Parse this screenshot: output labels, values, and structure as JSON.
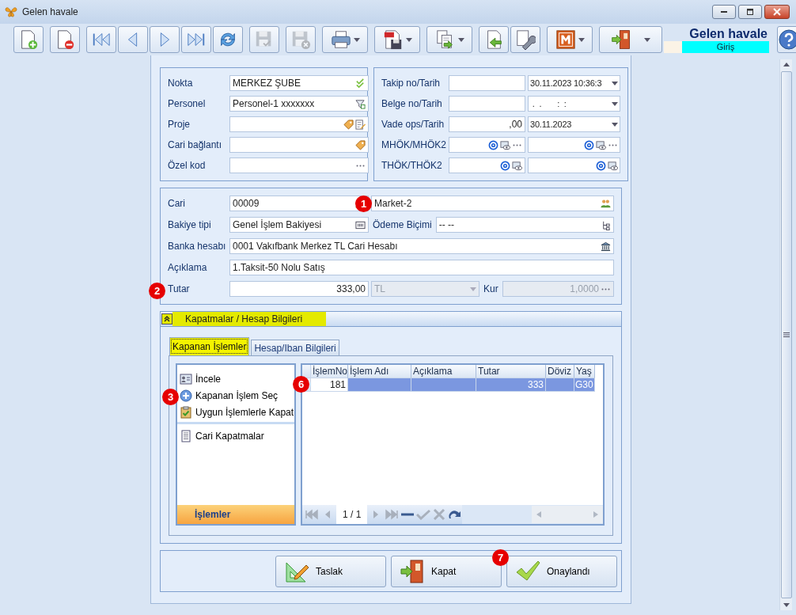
{
  "window": {
    "title": "Gelen havale"
  },
  "toolbar": [
    [
      {
        "kind": "new",
        "disabled": false
      }
    ],
    [
      {
        "kind": "delete",
        "disabled": false
      }
    ],
    [
      {
        "kind": "first",
        "disabled": false
      },
      {
        "kind": "prev",
        "disabled": false
      },
      {
        "kind": "next",
        "disabled": false
      },
      {
        "kind": "last",
        "disabled": false
      },
      {
        "kind": "refresh",
        "disabled": false
      }
    ],
    [
      {
        "kind": "save",
        "disabled": true
      }
    ],
    [
      {
        "kind": "save-cancel",
        "disabled": true
      }
    ],
    [
      {
        "kind": "print",
        "disabled": false,
        "dropdown": true
      }
    ],
    [
      {
        "kind": "pdf",
        "disabled": false,
        "dropdown": true
      }
    ],
    [
      {
        "kind": "export",
        "disabled": false,
        "dropdown": true
      }
    ],
    [
      {
        "kind": "import",
        "disabled": false
      },
      {
        "kind": "tools",
        "disabled": false
      }
    ],
    [
      {
        "kind": "module",
        "disabled": false,
        "dropdown": true
      }
    ],
    [
      {
        "kind": "exit",
        "disabled": false,
        "dropdown": true
      }
    ]
  ],
  "header": {
    "title": "Gelen havale",
    "mode": "Giriş"
  },
  "general_left": [
    {
      "label": "Nokta",
      "field": {
        "kind": "text",
        "value": "MERKEZ ŞUBE",
        "icons": [
          {
            "kind": "check"
          }
        ]
      }
    },
    {
      "label": "Personel",
      "field": {
        "kind": "text",
        "value": "Personel-1 xxxxxxx",
        "icons": [
          {
            "kind": "filter"
          }
        ]
      }
    },
    {
      "label": "Proje",
      "field": {
        "kind": "text",
        "icons": [
          {
            "kind": "tag"
          },
          {
            "kind": "edit"
          }
        ]
      }
    },
    {
      "label": "Cari bağlantı",
      "field": {
        "kind": "text",
        "icons": [
          {
            "kind": "tag"
          }
        ]
      }
    },
    {
      "label": "Özel kod",
      "field": {
        "kind": "text",
        "icons": [
          {
            "kind": "dots"
          }
        ]
      }
    }
  ],
  "general_right": [
    {
      "label": "Takip no/Tarih",
      "fields": [
        {
          "kind": "text"
        },
        {
          "kind": "select",
          "value": "30.11.2023 10:36:3"
        }
      ]
    },
    {
      "label": "Belge no/Tarih",
      "fields": [
        {
          "kind": "text"
        },
        {
          "kind": "select",
          "value": " .  .       :  :"
        }
      ]
    },
    {
      "label": "Vade ops/Tarih",
      "fields": [
        {
          "kind": "amount",
          "value": ",00"
        },
        {
          "kind": "select",
          "value": "30.11.2023"
        }
      ]
    },
    {
      "label": "MHÖK/MHÖK2",
      "fields": [
        {
          "kind": "text",
          "icons": [
            {
              "kind": "at"
            },
            {
              "kind": "eye"
            },
            {
              "kind": "dots"
            }
          ]
        },
        {
          "kind": "text",
          "icons": [
            {
              "kind": "at"
            },
            {
              "kind": "eye"
            },
            {
              "kind": "dots"
            }
          ]
        }
      ]
    },
    {
      "label": "THÖK/THÖK2",
      "fields": [
        {
          "kind": "text",
          "icons": [
            {
              "kind": "at"
            },
            {
              "kind": "eye"
            }
          ]
        },
        {
          "kind": "text",
          "icons": [
            {
              "kind": "at"
            },
            {
              "kind": "eye"
            }
          ]
        }
      ]
    }
  ],
  "account_rows": [
    {
      "items": [
        {
          "kind": "label",
          "text": "Cari"
        },
        {
          "kind": "field",
          "value": "00009",
          "icons": [
            {
              "kind": "people"
            }
          ],
          "disabled": false
        },
        {
          "kind": "field",
          "value": "Market-2",
          "icons": [
            {
              "kind": "people"
            }
          ],
          "disabled": false,
          "badge": "1"
        }
      ]
    },
    {
      "items": [
        {
          "kind": "label",
          "text": "Bakiye tipi"
        },
        {
          "kind": "field",
          "value": "Genel İşlem Bakiyesi",
          "icons": [
            {
              "kind": "barcode"
            }
          ],
          "disabled": false
        },
        {
          "kind": "label",
          "text": "Ödeme Biçimi"
        },
        {
          "kind": "field",
          "value": "-- --",
          "icons": [
            {
              "kind": "tree"
            }
          ],
          "disabled": false
        }
      ]
    },
    {
      "items": [
        {
          "kind": "label",
          "text": "Banka hesabı"
        },
        {
          "kind": "field",
          "value": "0001 Vakıfbank Merkez TL Cari Hesabı",
          "icons": [
            {
              "kind": "bank"
            }
          ],
          "disabled": false
        }
      ]
    },
    {
      "items": [
        {
          "kind": "label",
          "text": "Açıklama"
        },
        {
          "kind": "field",
          "value": "1.Taksit-50 Nolu Satış",
          "disabled": false
        }
      ]
    },
    {
      "items": [
        {
          "kind": "label",
          "text": "Tutar",
          "badge": "2"
        },
        {
          "kind": "amount",
          "value": "333,00",
          "disabled": false
        },
        {
          "kind": "select",
          "value": "TL",
          "disabled": true
        },
        {
          "kind": "label",
          "text": "Kur"
        },
        {
          "kind": "amount",
          "value": "1,0000",
          "icons": [
            {
              "kind": "dots"
            }
          ],
          "disabled": true
        }
      ]
    }
  ],
  "closings": {
    "title": "Kapatmalar / Hesap Bilgileri",
    "expanded": true,
    "tabs": [
      {
        "label": "Kapanan İşlemler",
        "selected": true
      },
      {
        "label": "Hesap/Iban Bilgileri",
        "selected": false
      }
    ],
    "action_groups": [
      [
        {
          "label": "İncele",
          "kind": "inspect"
        },
        {
          "label": "Kapanan İşlem Seç",
          "kind": "add",
          "badge": "3"
        },
        {
          "label": "Uygun İşlemlerle Kapat",
          "kind": "clipboard"
        }
      ],
      [
        {
          "label": "Cari Kapatmalar",
          "kind": "document"
        }
      ]
    ],
    "actions_footer": "İşlemler",
    "grid": {
      "columns": [
        "İşlemNo",
        "İşlem Adı",
        "Açıklama",
        "Tutar",
        "Döviz",
        "Yaş"
      ],
      "rows": [
        {
          "selected": true,
          "badge": "6",
          "cells": [
            {
              "text": "181",
              "focused": true
            },
            {
              "text": "",
              "focused": false
            },
            {
              "text": "",
              "focused": false
            },
            {
              "text": "333",
              "focused": false
            },
            {
              "text": "",
              "focused": false
            },
            {
              "text": "G30",
              "focused": false
            }
          ]
        }
      ]
    },
    "pager": "1 / 1"
  },
  "buttons": [
    {
      "label": "Taslak",
      "kind": "draft"
    },
    {
      "label": "Kapat",
      "kind": "exit"
    },
    {
      "label": "Onaylandı",
      "kind": "check",
      "badge": "7"
    }
  ]
}
